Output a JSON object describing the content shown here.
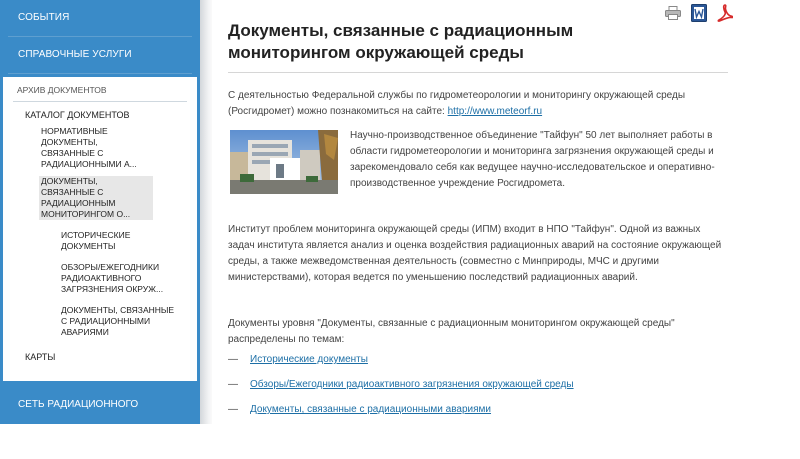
{
  "sidebar": {
    "top_items": [
      "СОБЫТИЯ",
      "СПРАВОЧНЫЕ УСЛУГИ"
    ],
    "archive": "АРХИВ ДОКУМЕНТОВ",
    "catalog": "КАТАЛОГ ДОКУМЕНТОВ",
    "catalog_items": [
      "НОРМАТИВНЫЕ ДОКУМЕНТЫ, СВЯЗАННЫЕ С РАДИАЦИОННЫМИ А...",
      "ДОКУМЕНТЫ, СВЯЗАННЫЕ С РАДИАЦИОННЫМ МОНИТОРИНГОМ О..."
    ],
    "sub_items": [
      "ИСТОРИЧЕСКИЕ ДОКУМЕНТЫ",
      "ОБЗОРЫ/ЕЖЕГОДНИКИ РАДИОАКТИВНОГО ЗАГРЯЗНЕНИЯ ОКРУЖ...",
      "ДОКУМЕНТЫ, СВЯЗАННЫЕ С РАДИАЦИОННЫМИ АВАРИЯМИ"
    ],
    "maps": "КАРТЫ",
    "bottom_item": "СЕТЬ РАДИАЦИОННОГО МОНИТОРИНГА"
  },
  "main": {
    "title": "Документы, связанные с радиационным мониторингом окружающей среды",
    "intro_text": "С деятельностью Федеральной службы по гидрометеорологии и мониторингу окружающей среды (Росгидромет) можно познакомиться на сайте: ",
    "intro_link": "http://www.meteorf.ru",
    "photo_text": "Научно-производственное объединение \"Тайфун\" 50 лет выполняет работы в области гидрометеорологии и мониторинга загрязнения окружающей среды и зарекомендовало себя как ведущее научно-исследовательское и оперативно- производственное учреждение Росгидромета.",
    "para2": "Институт проблем мониторинга окружающей среды (ИПМ) входит в НПО \"Тайфун\". Одной из важных задач института является анализ и оценка воздействия радиационных аварий на состояние окружающей среды, а также межведомственная деятельность (совместно с Минприроды, МЧС и другими министерствами), которая ведется по уменьшению последствий радиационных аварий.",
    "para3": "Документы уровня \"Документы, связанные с радиационным мониторингом окружающей среды\" распределены по темам:",
    "topic_dash": "—",
    "topics": [
      "Исторические документы",
      "Обзоры/Ежегодники радиоактивного загрязнения окружающей среды",
      "Документы, связанные с радиационными авариями"
    ]
  },
  "colors": {
    "sidebar_blue": "#3a8bc8",
    "link": "#1d6fa6",
    "pdf_red": "#d62b2b",
    "word_blue": "#2b5797"
  },
  "icons": [
    "print-icon",
    "word-icon",
    "pdf-icon"
  ]
}
